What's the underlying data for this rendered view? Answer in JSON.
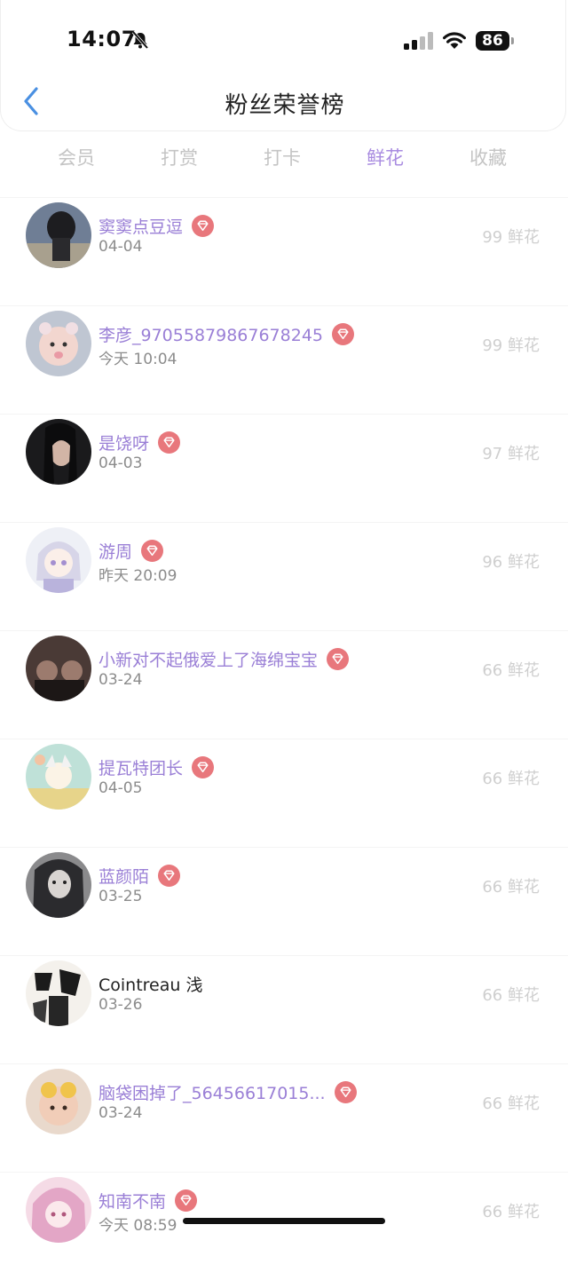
{
  "status_bar": {
    "time": "14:07",
    "battery": "86"
  },
  "header": {
    "title": "粉丝荣誉榜"
  },
  "tabs": [
    {
      "label": "会员"
    },
    {
      "label": "打赏"
    },
    {
      "label": "打卡"
    },
    {
      "label": "鲜花",
      "active": true
    },
    {
      "label": "收藏"
    }
  ],
  "fans": [
    {
      "name": "窦窦点豆逗",
      "date": "04-04",
      "count": "99 鲜花",
      "vip": true
    },
    {
      "name": "李彦_97055879867678245",
      "date": "今天 10:04",
      "count": "99 鲜花",
      "vip": true
    },
    {
      "name": "是饶呀",
      "date": "04-03",
      "count": "97 鲜花",
      "vip": true
    },
    {
      "name": "游周",
      "date": "昨天 20:09",
      "count": "96 鲜花",
      "vip": true
    },
    {
      "name": "小新对不起俄爱上了海绵宝宝",
      "date": "03-24",
      "count": "66 鲜花",
      "vip": true
    },
    {
      "name": "提瓦特团长",
      "date": "04-05",
      "count": "66 鲜花",
      "vip": true
    },
    {
      "name": "蓝颜陌",
      "date": "03-25",
      "count": "66 鲜花",
      "vip": true
    },
    {
      "name": "Cointreau 浅",
      "date": "03-26",
      "count": "66 鲜花",
      "vip": false
    },
    {
      "name": "脑袋困掉了_56456617015...",
      "date": "03-24",
      "count": "66 鲜花",
      "vip": true
    },
    {
      "name": "知南不南",
      "date": "今天 08:59",
      "count": "66 鲜花",
      "vip": true
    }
  ],
  "colors": {
    "accent": "#a98ce0",
    "name": "#9a7fd6",
    "badge": "#e8777c",
    "back_arrow": "#4a90e2"
  }
}
